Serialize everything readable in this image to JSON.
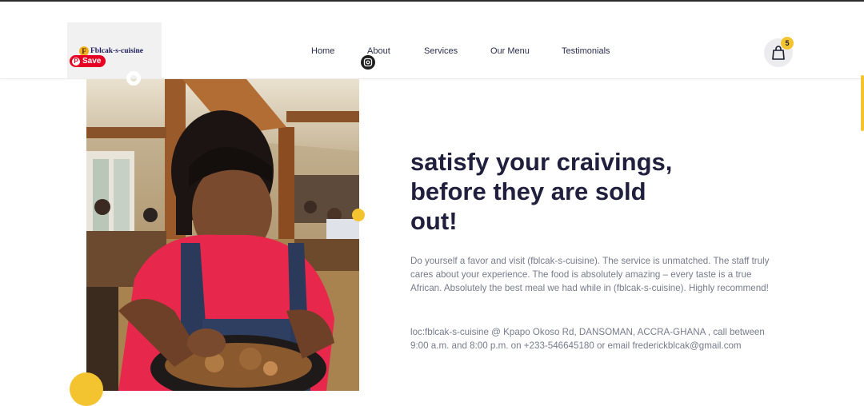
{
  "brand": {
    "mark": "F",
    "name": "Fblcak-s-cuisine"
  },
  "pinterest": {
    "save_label": "Save",
    "mark": "P"
  },
  "nav": {
    "items": [
      {
        "label": "Home"
      },
      {
        "label": "About"
      },
      {
        "label": "Services"
      },
      {
        "label": "Our Menu"
      },
      {
        "label": "Testimonials"
      }
    ]
  },
  "cart": {
    "count": "5",
    "icon": "shopping-bag-icon"
  },
  "hero": {
    "title": "satisfy your craivings, before they are sold out!",
    "description": "Do yourself a favor and visit (fblcak-s-cuisine). The service is unmatched. The staff truly cares about your experience. The food is absolutely amazing – every taste is a true African. Absolutely the best meal we had while in (fblcak-s-cuisine). Highly recommend!",
    "contact": "loc:fblcak-s-cuisine @ Kpapo Okoso Rd, DANSOMAN, ACCRA-GHANA , call between 9:00 a.m. and 8:00 p.m. on +233-546645180 or email frederickblcak@gmail.com"
  },
  "colors": {
    "accent": "#f4c430",
    "heading": "#20203e",
    "body_text": "#777a8c",
    "pinterest": "#e60023"
  }
}
